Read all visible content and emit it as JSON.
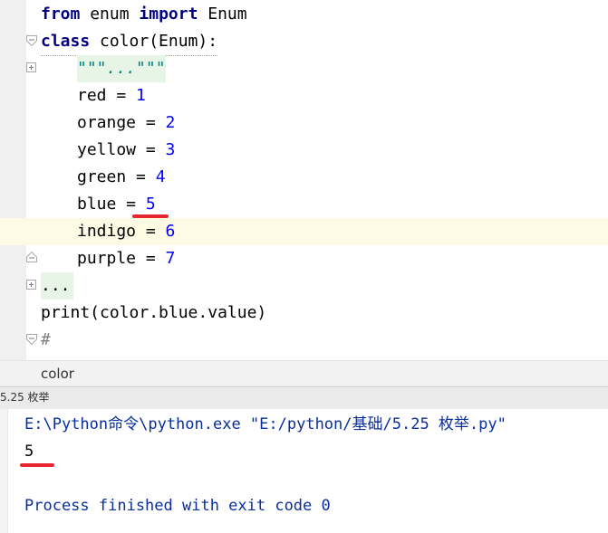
{
  "editor": {
    "import_line": {
      "kw1": "from",
      "mod": " enum ",
      "kw2": "import",
      "name": " Enum"
    },
    "class_line": {
      "kw": "class",
      "rest": " color(Enum):"
    },
    "docstring": "\"\"\"...\"\"\"",
    "members": [
      {
        "name": "red = ",
        "value": "1"
      },
      {
        "name": "orange = ",
        "value": "2"
      },
      {
        "name": "yellow = ",
        "value": "3"
      },
      {
        "name": "green = ",
        "value": "4"
      },
      {
        "name": "blue = ",
        "value": "5"
      },
      {
        "name": "indigo = ",
        "value": "6"
      },
      {
        "name": "purple = ",
        "value": "7"
      }
    ],
    "folded_block": "...",
    "print_line": "print(color.blue.value)",
    "comment_line": "#"
  },
  "breadcrumb": {
    "item": "color"
  },
  "run_panel": {
    "tab_label": "5.25 枚举",
    "command": "E:\\Python命令\\python.exe \"E:/python/基础/5.25 枚举.py\"",
    "output": "5",
    "exit_message": "Process finished with exit code 0"
  },
  "colors": {
    "keyword": "#000080",
    "number": "#0000ff",
    "annotation_red": "#e8262f",
    "caret_line": "#fffae3",
    "console_text": "#0a2f9c"
  }
}
